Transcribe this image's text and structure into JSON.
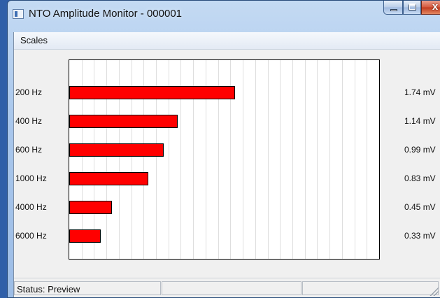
{
  "window": {
    "title": "NTO Amplitude Monitor - 000001",
    "close_label": "x"
  },
  "menu": {
    "items": [
      {
        "label": "Scales"
      }
    ]
  },
  "chart_data": {
    "type": "bar",
    "orientation": "horizontal",
    "categories": [
      "200 Hz",
      "400 Hz",
      "600 Hz",
      "1000 Hz",
      "4000 Hz",
      "6000 Hz"
    ],
    "values": [
      1.74,
      1.14,
      0.99,
      0.83,
      0.45,
      0.33
    ],
    "value_labels": [
      "1.74 mV",
      "1.14 mV",
      "0.99 mV",
      "0.83 mV",
      "0.45 mV",
      "0.33 mV"
    ],
    "unit": "mV",
    "xlim": [
      0,
      3.25
    ],
    "grid": true,
    "grid_count": 25,
    "bar_color": "#ff0000"
  },
  "status": {
    "text": "Status: Preview"
  }
}
